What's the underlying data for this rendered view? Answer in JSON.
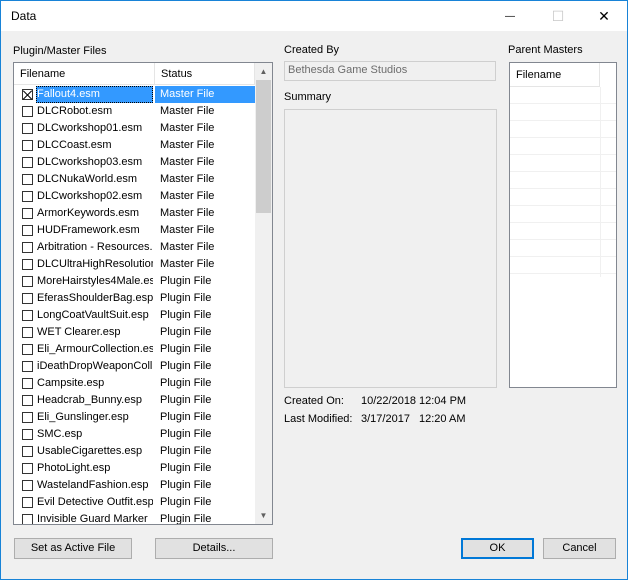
{
  "window": {
    "title": "Data",
    "minimize_glyph": "—",
    "maximize_glyph": "☐",
    "close_glyph": "✕"
  },
  "plugins": {
    "label": "Plugin/Master Files",
    "headers": {
      "filename": "Filename",
      "status": "Status"
    },
    "rows": [
      {
        "name": "Fallout4.esm",
        "status": "Master File",
        "checked": true,
        "selected": true
      },
      {
        "name": "DLCRobot.esm",
        "status": "Master File"
      },
      {
        "name": "DLCworkshop01.esm",
        "status": "Master File"
      },
      {
        "name": "DLCCoast.esm",
        "status": "Master File"
      },
      {
        "name": "DLCworkshop03.esm",
        "status": "Master File"
      },
      {
        "name": "DLCNukaWorld.esm",
        "status": "Master File"
      },
      {
        "name": "DLCworkshop02.esm",
        "status": "Master File"
      },
      {
        "name": "ArmorKeywords.esm",
        "status": "Master File"
      },
      {
        "name": "HUDFramework.esm",
        "status": "Master File"
      },
      {
        "name": "Arbitration - Resources.esm",
        "status": "Master File"
      },
      {
        "name": "DLCUltraHighResolution.esm",
        "status": "Master File"
      },
      {
        "name": "MoreHairstyles4Male.esp",
        "status": "Plugin File"
      },
      {
        "name": "EferasShoulderBag.esp",
        "status": "Plugin File"
      },
      {
        "name": "LongCoatVaultSuit.esp",
        "status": "Plugin File"
      },
      {
        "name": "WET Clearer.esp",
        "status": "Plugin File"
      },
      {
        "name": "Eli_ArmourCollection.esp",
        "status": "Plugin File"
      },
      {
        "name": "iDeathDropWeaponCollision.esp",
        "status": "Plugin File"
      },
      {
        "name": "Campsite.esp",
        "status": "Plugin File"
      },
      {
        "name": "Headcrab_Bunny.esp",
        "status": "Plugin File"
      },
      {
        "name": "Eli_Gunslinger.esp",
        "status": "Plugin File"
      },
      {
        "name": "SMC.esp",
        "status": "Plugin File"
      },
      {
        "name": "UsableCigarettes.esp",
        "status": "Plugin File"
      },
      {
        "name": "PhotoLight.esp",
        "status": "Plugin File"
      },
      {
        "name": "WastelandFashion.esp",
        "status": "Plugin File"
      },
      {
        "name": "Evil Detective Outfit.esp",
        "status": "Plugin File"
      },
      {
        "name": "Invisible Guard Marker",
        "status": "Plugin File"
      }
    ]
  },
  "details": {
    "created_by_label": "Created By",
    "created_by_value": "Bethesda Game Studios",
    "summary_label": "Summary",
    "created_on_label": "Created On:",
    "created_on_date": "10/22/2018",
    "created_on_time": "12:04 PM",
    "last_modified_label": "Last Modified:",
    "last_modified_date": "3/17/2017",
    "last_modified_time": "12:20 AM"
  },
  "parent_masters": {
    "label": "Parent Masters",
    "header": "Filename"
  },
  "buttons": {
    "set_active": "Set as Active File",
    "details": "Details...",
    "ok": "OK",
    "cancel": "Cancel"
  }
}
